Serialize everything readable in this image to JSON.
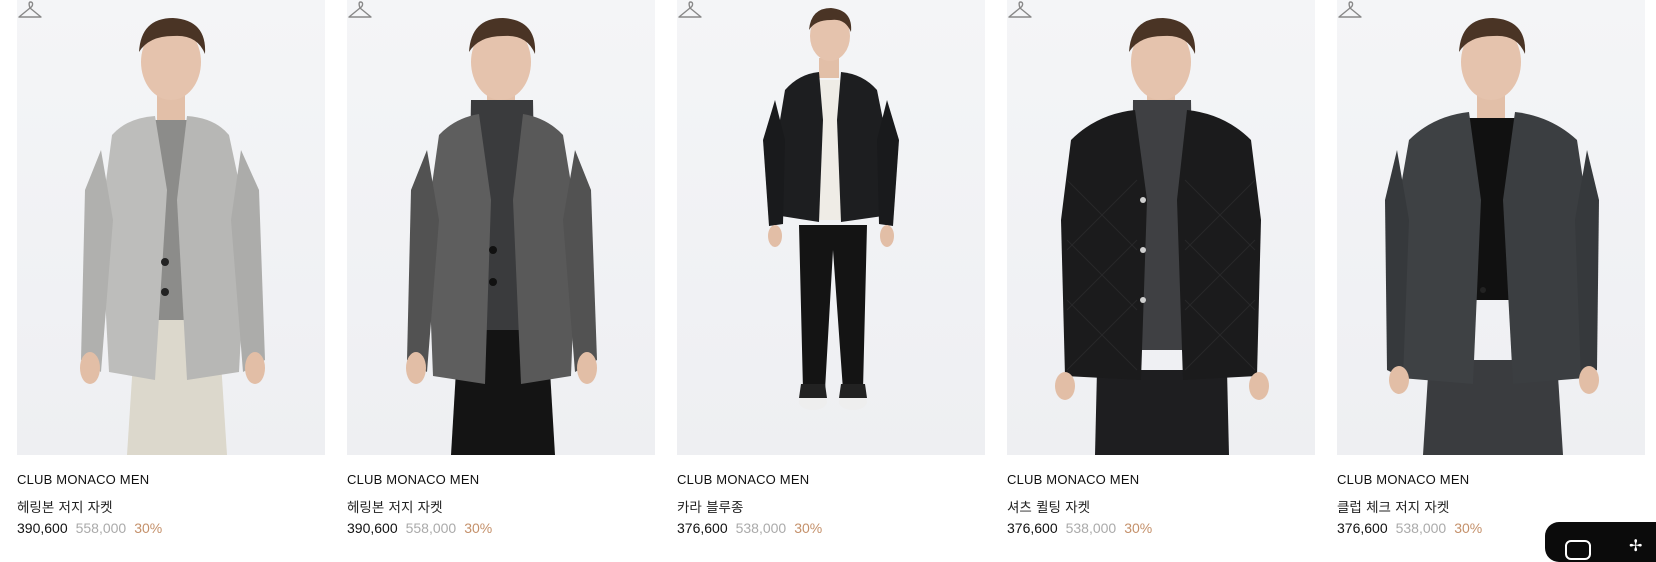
{
  "products": [
    {
      "brand": "CLUB MONACO MEN",
      "name": "헤링본 저지 자켓",
      "price": "390,600",
      "original_price": "558,000",
      "discount": "30%",
      "image_desc": "light grey herringbone jersey jacket with grey tee and beige pants",
      "colors": {
        "jacket": "#bdbdbb",
        "inner": "#8c8c8a",
        "pants": "#dcd8cc"
      }
    },
    {
      "brand": "CLUB MONACO MEN",
      "name": "헤링본 저지 자켓",
      "price": "390,600",
      "original_price": "558,000",
      "discount": "30%",
      "image_desc": "dark grey herringbone jersey jacket with charcoal turtleneck",
      "colors": {
        "jacket": "#5e5e5e",
        "inner": "#3a3b3d",
        "pants": "#141414"
      }
    },
    {
      "brand": "CLUB MONACO MEN",
      "name": "카라 블루종",
      "price": "376,600",
      "original_price": "538,000",
      "discount": "30%",
      "image_desc": "black collared blouson with black pants and sneakers, full body",
      "colors": {
        "jacket": "#1d1e20",
        "inner": "#efece6",
        "pants": "#141414"
      }
    },
    {
      "brand": "CLUB MONACO MEN",
      "name": "셔츠 퀼팅 자켓",
      "price": "376,600",
      "original_price": "538,000",
      "discount": "30%",
      "image_desc": "black quilted shirt jacket with grey turtleneck",
      "colors": {
        "jacket": "#1b1b1c",
        "inner": "#3f4043",
        "pants": "#1e1e20"
      }
    },
    {
      "brand": "CLUB MONACO MEN",
      "name": "클럽 체크 저지 자켓",
      "price": "376,600",
      "original_price": "538,000",
      "discount": "30%",
      "image_desc": "charcoal check jersey jacket with black tee and matching trousers",
      "colors": {
        "jacket": "#3e4144",
        "inner": "#111111",
        "pants": "#3a3c3f"
      }
    }
  ],
  "icons": {
    "wishlist": "hanger-icon"
  },
  "colors": {
    "discount": "#c4906a",
    "original_price": "#aaaaaa",
    "photo_bg": "#f2f3f5"
  }
}
